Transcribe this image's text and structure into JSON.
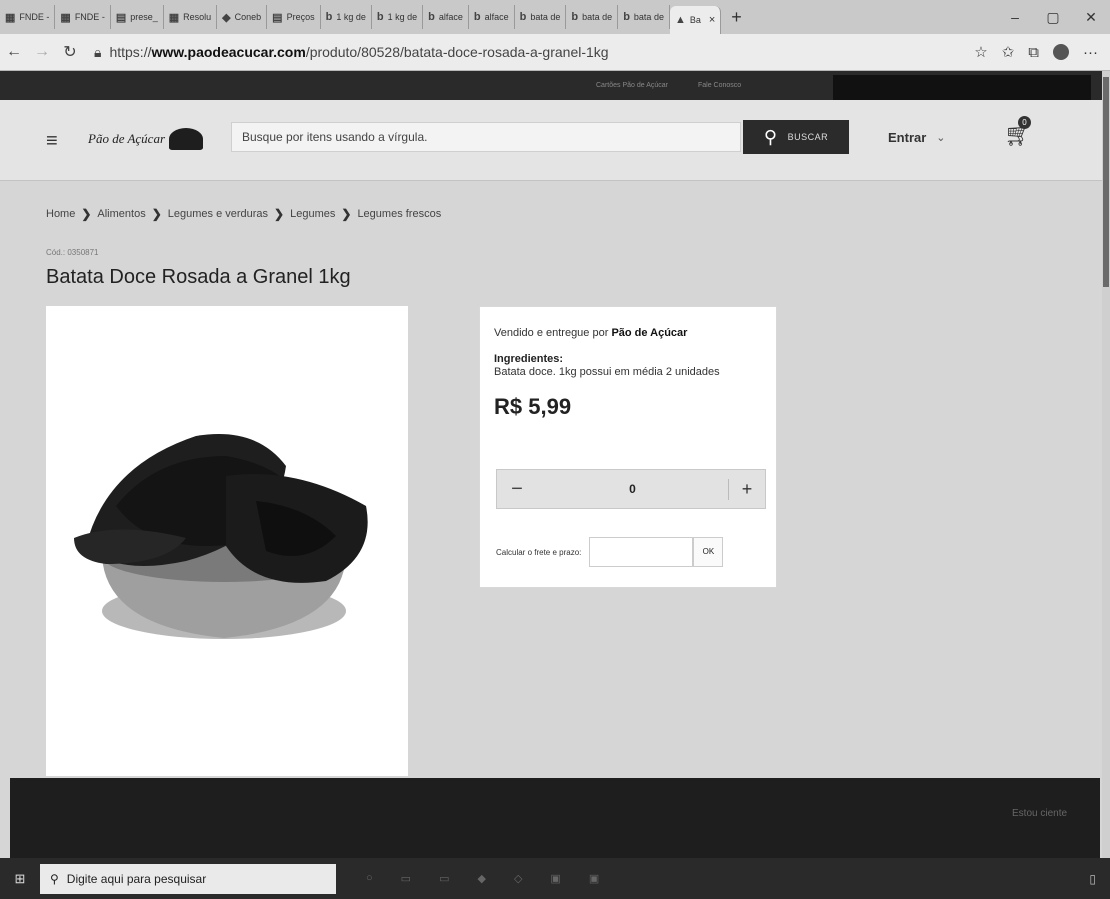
{
  "browser": {
    "tabs": [
      {
        "label": "FNDE -",
        "icon": "fnde-icon"
      },
      {
        "label": "FNDE -",
        "icon": "fnde-icon"
      },
      {
        "label": "prese_",
        "icon": "doc-icon"
      },
      {
        "label": "Resolu",
        "icon": "fnde-icon"
      },
      {
        "label": "Coneb",
        "icon": "coneb-icon"
      },
      {
        "label": "Preços",
        "icon": "doc-icon"
      },
      {
        "label": "1 kg de",
        "icon": "bing-icon"
      },
      {
        "label": "1 kg de",
        "icon": "bing-icon"
      },
      {
        "label": "alface",
        "icon": "bing-icon"
      },
      {
        "label": "alface",
        "icon": "bing-icon"
      },
      {
        "label": "bata de",
        "icon": "bing-icon"
      },
      {
        "label": "bata de",
        "icon": "bing-icon"
      },
      {
        "label": "bata de",
        "icon": "bing-icon"
      }
    ],
    "active_tab": {
      "label": "Ba"
    },
    "url_prefix": "https://",
    "url_host": "www.paodeacucar.com",
    "url_path": "/produto/80528/batata-doce-rosada-a-granel-1kg"
  },
  "site": {
    "top_links": [
      "Cartões Pão de Açúcar",
      "Fale Conosco"
    ],
    "logo_text": "Pão de Açúcar",
    "search_placeholder": "Busque por itens usando a vírgula.",
    "search_button": "BUSCAR",
    "login_label": "Entrar",
    "cart_count": "0"
  },
  "breadcrumb": [
    "Home",
    "Alimentos",
    "Legumes e verduras",
    "Legumes",
    "Legumes frescos"
  ],
  "product": {
    "code": "Cód.: 0350871",
    "title": "Batata Doce Rosada a Granel 1kg",
    "seller_prefix": "Vendido e entregue por",
    "seller_name": "Pão de Açúcar",
    "ingredients_title": "Ingredientes:",
    "ingredients_text": "Batata doce. 1kg possui em média 2 unidades",
    "price": "R$ 5,99",
    "quantity": "0",
    "minus": "−",
    "plus": "+",
    "shipping_label": "Calcular o frete e prazo:",
    "ok_label": "OK"
  },
  "cookie": {
    "button": "Estou ciente"
  },
  "taskbar": {
    "search_placeholder": "Digite aqui para pesquisar"
  }
}
